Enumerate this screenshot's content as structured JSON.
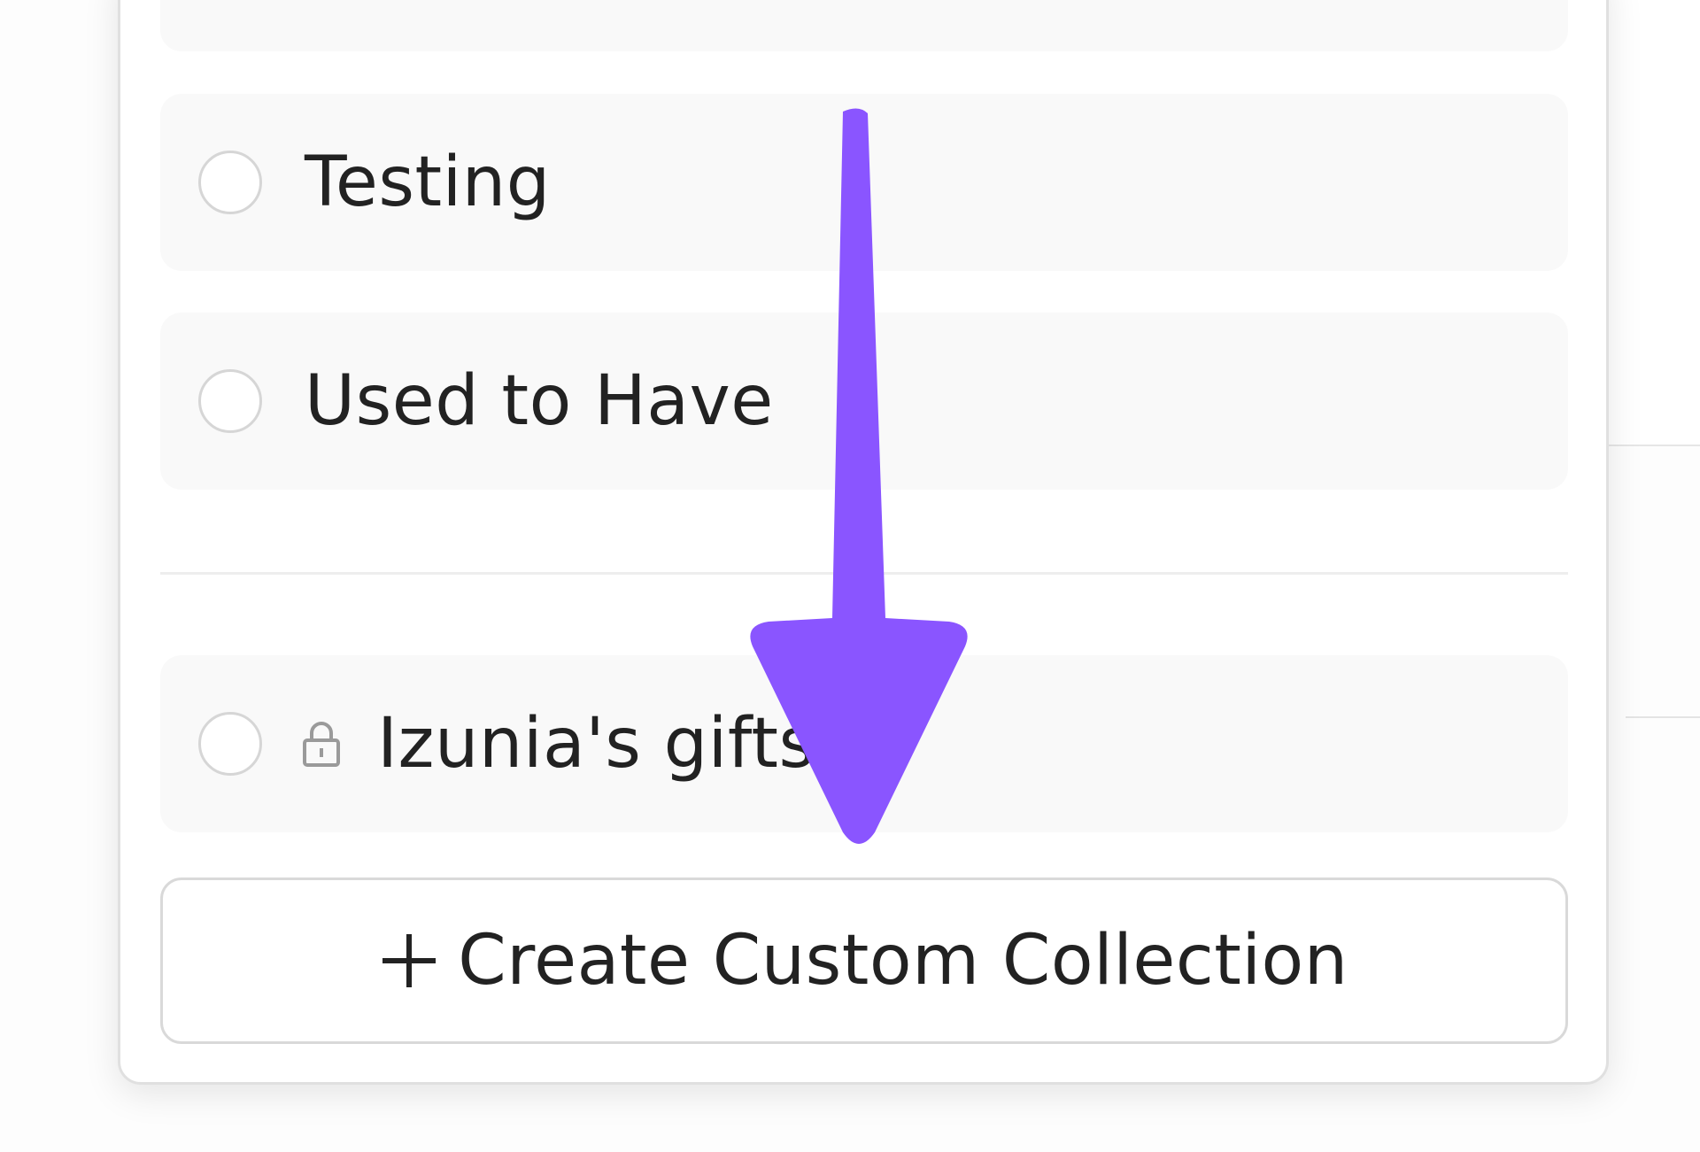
{
  "collections": {
    "items": [
      {
        "label": "Testing",
        "locked": false
      },
      {
        "label": "Used to Have",
        "locked": false
      },
      {
        "label": "Izunia's gifts",
        "locked": true
      }
    ]
  },
  "create_button": {
    "label": "Create Custom Collection",
    "icon": "plus-icon"
  },
  "annotation": {
    "arrow_color": "#8a55ff",
    "icon": "arrow-down-icon"
  },
  "colors": {
    "item_background": "#f9f9f9",
    "text": "#222222",
    "border": "#d9d9d9"
  }
}
